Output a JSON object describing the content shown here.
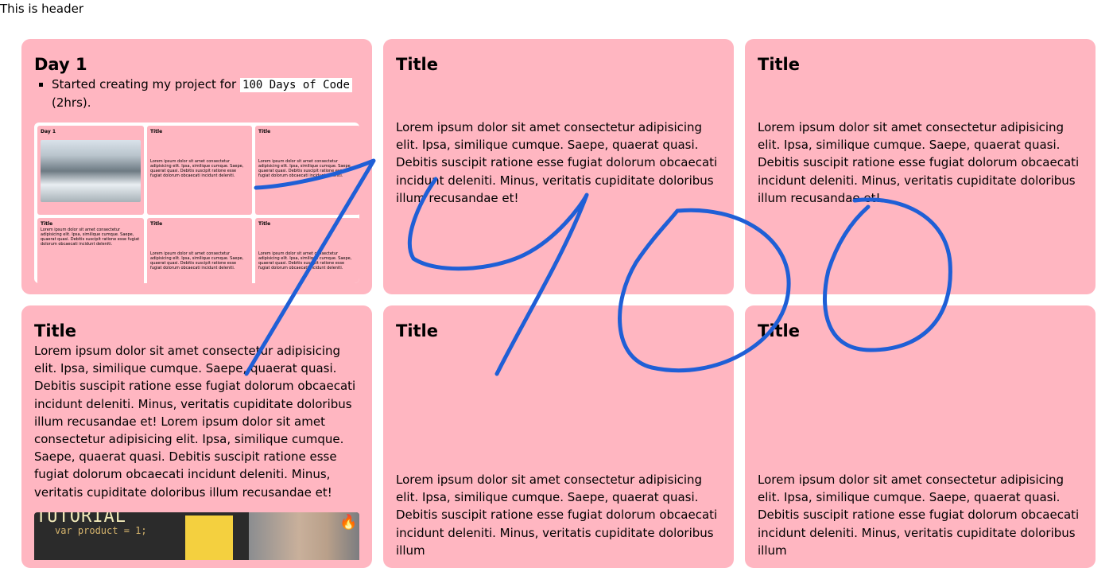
{
  "header": {
    "text": "This is header"
  },
  "cards": {
    "day1": {
      "title": "Day 1",
      "item_prefix": "Started creating my project for",
      "item_code": "100 Days of Code",
      "item_suffix": "(2hrs)."
    },
    "card2": {
      "title": "Title",
      "body": "Lorem ipsum dolor sit amet consectetur adipisicing elit. Ipsa, similique cumque. Saepe, quaerat quasi. Debitis suscipit ratione esse fugiat dolorum obcaecati incidunt deleniti. Minus, veritatis cupiditate doloribus illum recusandae et!"
    },
    "card3": {
      "title": "Title",
      "body": "Lorem ipsum dolor sit amet consectetur adipisicing elit. Ipsa, similique cumque. Saepe, quaerat quasi. Debitis suscipit ratione esse fugiat dolorum obcaecati incidunt deleniti. Minus, veritatis cupiditate doloribus illum recusandae et!"
    },
    "card4": {
      "title": "Title",
      "body": "Lorem ipsum dolor sit amet consectetur adipisicing elit. Ipsa, similique cumque. Saepe, quaerat quasi. Debitis suscipit ratione esse fugiat dolorum obcaecati incidunt deleniti. Minus, veritatis cupiditate doloribus illum recusandae et! Lorem ipsum dolor sit amet consectetur adipisicing elit. Ipsa, similique cumque. Saepe, quaerat quasi. Debitis suscipit ratione esse fugiat dolorum obcaecati incidunt deleniti. Minus, veritatis cupiditate doloribus illum recusandae et!"
    },
    "card5": {
      "title": "Title",
      "body": "Lorem ipsum dolor sit amet consectetur adipisicing elit. Ipsa, similique cumque. Saepe, quaerat quasi. Debitis suscipit ratione esse fugiat dolorum obcaecati incidunt deleniti. Minus, veritatis cupiditate doloribus illum"
    },
    "card6": {
      "title": "Title",
      "body": "Lorem ipsum dolor sit amet consectetur adipisicing elit. Ipsa, similique cumque. Saepe, quaerat quasi. Debitis suscipit ratione esse fugiat dolorum obcaecati incidunt deleniti. Minus, veritatis cupiditate doloribus illum"
    }
  },
  "preview": {
    "mini_day_title": "Day 1",
    "mini_title": "Title",
    "mini_body": "Lorem ipsum dolor sit amet consectetur adipisicing elit. Ipsa, similique cumque. Saepe, quaerat quasi. Debitis suscipit ratione esse fugiat dolorum obcaecati incidunt deleniti."
  },
  "video": {
    "code_line1": "TUTORIAL",
    "code_line2": "var product = 1;",
    "icon": "flame-icon"
  },
  "drawing": {
    "handwritten_text": "1400",
    "stroke_color": "#1f5fd6"
  },
  "colors": {
    "card_bg": "#ffb6c1",
    "page_bg": "#ffffff"
  }
}
